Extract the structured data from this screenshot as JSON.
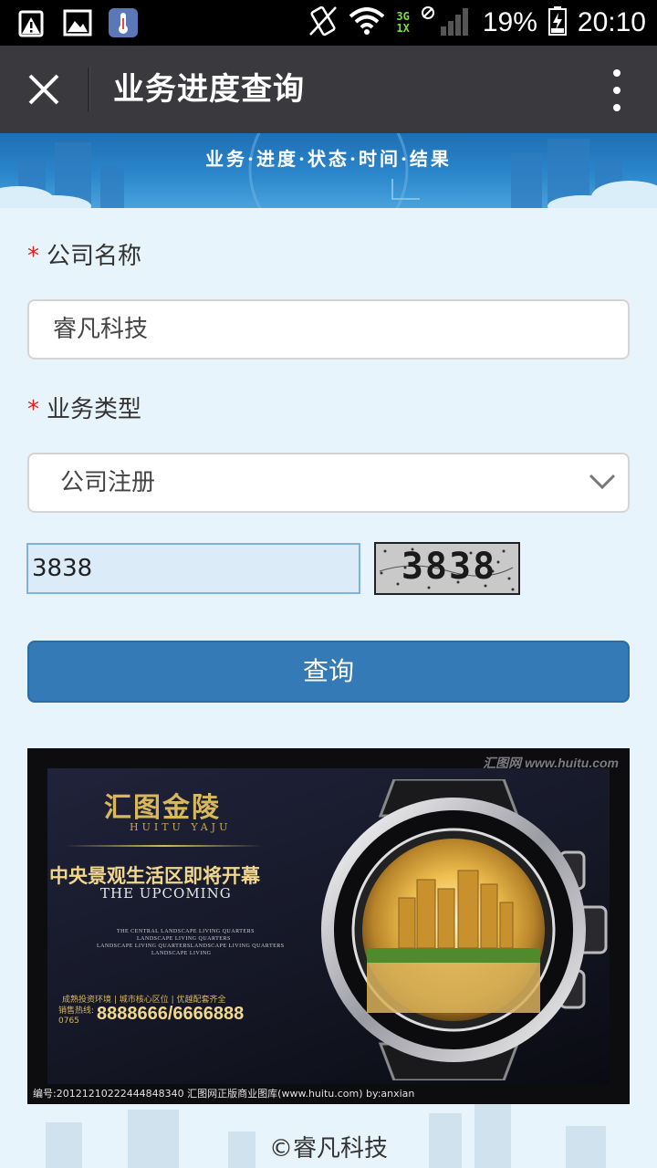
{
  "status_bar": {
    "net_top": "3G",
    "net_bottom": "1X",
    "battery": "19%",
    "time": "20:10"
  },
  "titlebar": {
    "title": "业务进度查询"
  },
  "banner": {
    "text": "业务·进度·状态·时间·结果"
  },
  "form": {
    "company_label": "公司名称",
    "company_value": "睿凡科技",
    "business_label": "业务类型",
    "business_value": "公司注册",
    "captcha_value": "3838",
    "captcha_image_text": "3838",
    "query_label": "查询"
  },
  "ad": {
    "watermark": "汇图网 www.huitu.com",
    "brand": "汇图金陵",
    "brand_sub": "HUITU YAJU",
    "headline": "中央景观生活区即将开幕",
    "upcoming": "THE UPCOMING",
    "small_lines": [
      "THE CENTRAL LANDSCAPE LIVING QUARTERS",
      "LANDSCAPE LIVING QUARTERS",
      "LANDSCAPE LIVING QUARTERSLANDSCAPE LIVING QUARTERS",
      "LANDSCAPE LIVING"
    ],
    "features": "成熟投资环境 | 城市核心区位 | 优越配套齐全",
    "hotline_label": "销售热线:",
    "area_code": "0765",
    "phone": "8888666/6666888",
    "footer": "编号:20121210222444848340  汇图网正版商业图库(www.huitu.com) by:anxian"
  },
  "footer": {
    "copyright": "©睿凡科技"
  },
  "colors": {
    "accent": "#337ab7",
    "titlebar": "#3a3a3e",
    "required": "#e02020",
    "background": "#e8f4fb"
  }
}
